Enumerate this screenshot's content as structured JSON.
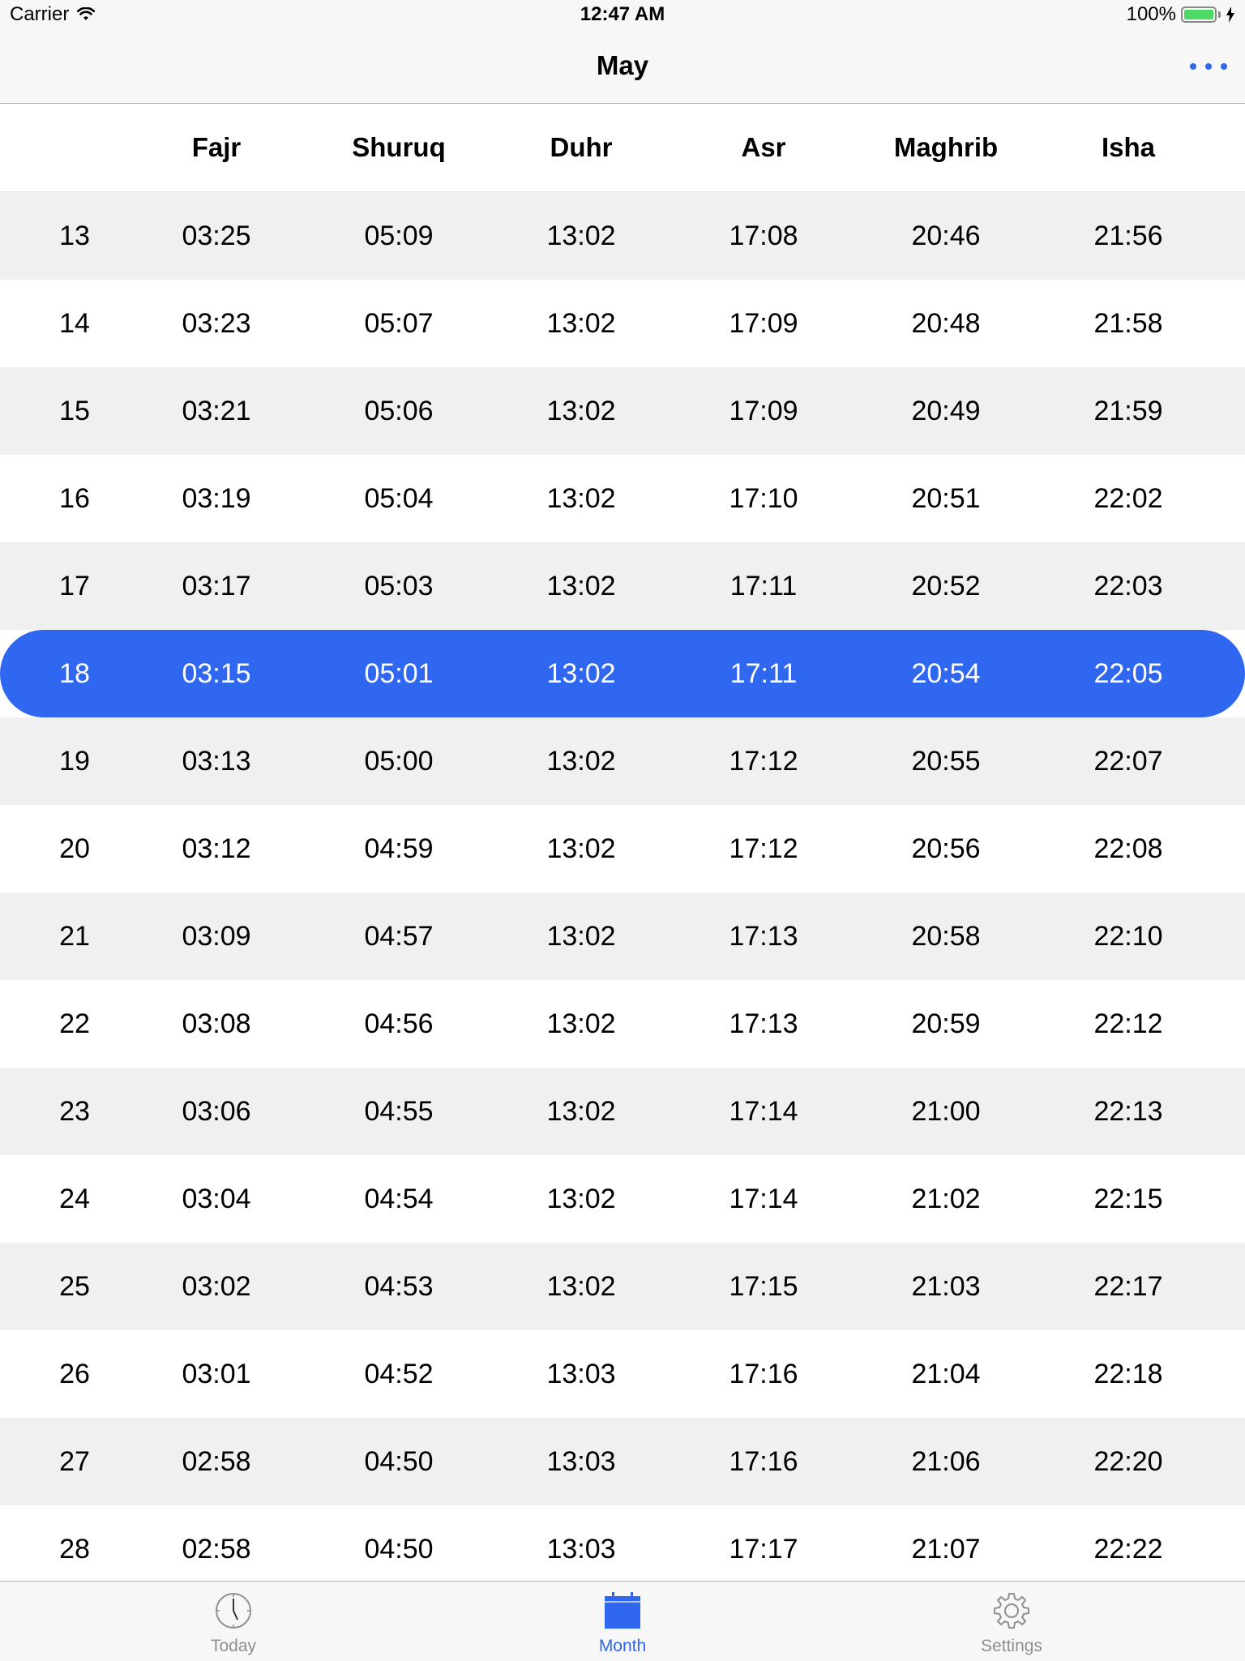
{
  "status_bar": {
    "carrier": "Carrier",
    "time": "12:47 AM",
    "battery_pct": "100%"
  },
  "nav": {
    "title": "May"
  },
  "columns": [
    "",
    "Fajr",
    "Shuruq",
    "Duhr",
    "Asr",
    "Maghrib",
    "Isha"
  ],
  "rows": [
    [
      "13",
      "03:25",
      "05:09",
      "13:02",
      "17:08",
      "20:46",
      "21:56"
    ],
    [
      "14",
      "03:23",
      "05:07",
      "13:02",
      "17:09",
      "20:48",
      "21:58"
    ],
    [
      "15",
      "03:21",
      "05:06",
      "13:02",
      "17:09",
      "20:49",
      "21:59"
    ],
    [
      "16",
      "03:19",
      "05:04",
      "13:02",
      "17:10",
      "20:51",
      "22:02"
    ],
    [
      "17",
      "03:17",
      "05:03",
      "13:02",
      "17:11",
      "20:52",
      "22:03"
    ],
    [
      "18",
      "03:15",
      "05:01",
      "13:02",
      "17:11",
      "20:54",
      "22:05"
    ],
    [
      "19",
      "03:13",
      "05:00",
      "13:02",
      "17:12",
      "20:55",
      "22:07"
    ],
    [
      "20",
      "03:12",
      "04:59",
      "13:02",
      "17:12",
      "20:56",
      "22:08"
    ],
    [
      "21",
      "03:09",
      "04:57",
      "13:02",
      "17:13",
      "20:58",
      "22:10"
    ],
    [
      "22",
      "03:08",
      "04:56",
      "13:02",
      "17:13",
      "20:59",
      "22:12"
    ],
    [
      "23",
      "03:06",
      "04:55",
      "13:02",
      "17:14",
      "21:00",
      "22:13"
    ],
    [
      "24",
      "03:04",
      "04:54",
      "13:02",
      "17:14",
      "21:02",
      "22:15"
    ],
    [
      "25",
      "03:02",
      "04:53",
      "13:02",
      "17:15",
      "21:03",
      "22:17"
    ],
    [
      "26",
      "03:01",
      "04:52",
      "13:03",
      "17:16",
      "21:04",
      "22:18"
    ],
    [
      "27",
      "02:58",
      "04:50",
      "13:03",
      "17:16",
      "21:06",
      "22:20"
    ],
    [
      "28",
      "02:58",
      "04:50",
      "13:03",
      "17:17",
      "21:07",
      "22:22"
    ]
  ],
  "highlighted_day": "18",
  "tabs": [
    {
      "label": "Today",
      "icon": "clock-icon",
      "active": false
    },
    {
      "label": "Month",
      "icon": "calendar-icon",
      "active": true
    },
    {
      "label": "Settings",
      "icon": "gear-icon",
      "active": false
    }
  ],
  "colors": {
    "accent": "#2f67f0",
    "row_shade": "#f0f0f0",
    "bar_bg": "#f7f7f7",
    "inactive_tab": "#8e8e93",
    "battery": "#4cd964"
  }
}
